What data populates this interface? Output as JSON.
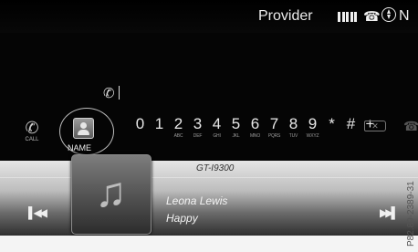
{
  "status_bar": {
    "provider_label": "Provider",
    "signal_bars": 5,
    "heading": "N",
    "icons": [
      "signal-bars-icon",
      "phone-handset-icon",
      "compass-icon"
    ]
  },
  "dial": {
    "input_icon": "phone-handset-icon",
    "input_value": ""
  },
  "call_button": {
    "icon": "phone-handset-icon",
    "label": "CALL"
  },
  "name_button": {
    "icon": "contact-card-icon",
    "label": "NAME"
  },
  "keypad": [
    {
      "digit": "0",
      "letters": ""
    },
    {
      "digit": "1",
      "letters": ""
    },
    {
      "digit": "2",
      "letters": "ABC"
    },
    {
      "digit": "3",
      "letters": "DEF"
    },
    {
      "digit": "4",
      "letters": "GHI"
    },
    {
      "digit": "5",
      "letters": "JKL"
    },
    {
      "digit": "6",
      "letters": "MNO"
    },
    {
      "digit": "7",
      "letters": "PQRS"
    },
    {
      "digit": "8",
      "letters": "TUV"
    },
    {
      "digit": "9",
      "letters": "WXYZ"
    },
    {
      "digit": "*",
      "letters": ""
    },
    {
      "digit": "#",
      "letters": ""
    },
    {
      "digit": "+",
      "letters": ""
    }
  ],
  "media": {
    "device": "GT-I9300",
    "artist": "Leona Lewis",
    "title": "Happy",
    "art_icon": "music-note-icon"
  },
  "figure_code": "P82.89-2389-31",
  "colors": {
    "background": "#050505",
    "player_top": "#e6e6e6",
    "player_bottom": "#2f2f2f",
    "text": "#e8e8e8"
  }
}
